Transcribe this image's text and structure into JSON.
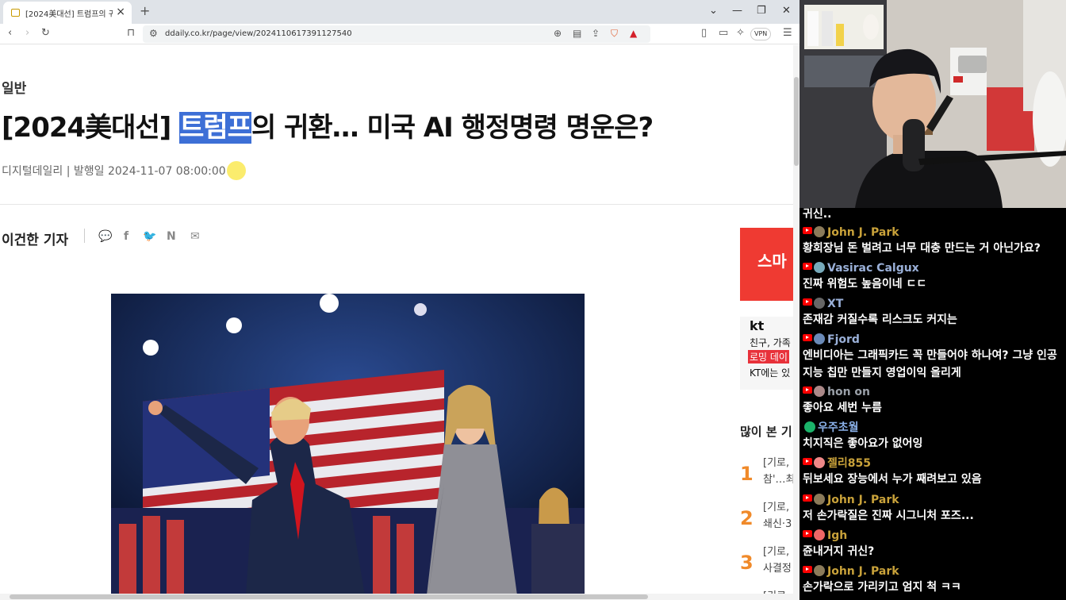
{
  "browser": {
    "tab_title": "[2024美대선] 트럼프의 귀환...",
    "url": "ddaily.co.kr/page/view/2024110617391127540",
    "vpn_label": "VPN"
  },
  "article": {
    "category": "일반",
    "headline_pre": "[2024美대선] ",
    "headline_highlight": "트럼프",
    "headline_post": "의 귀환… 미국 AI 행정명령 명운은?",
    "source": "디지털데일리",
    "date": "발행일 2024-11-07 08:00:00",
    "reporter": "이건한 기자"
  },
  "sidebar": {
    "ad1_text": "스마",
    "ad2_logo": "kt",
    "ad2_line1": "친구, 가족",
    "ad2_line2": "로밍 데이",
    "ad2_line3": "KT에는 있",
    "popular_title": "많이 본 기",
    "ranks": [
      {
        "num": "1",
        "line1": "[기로,",
        "line2": "참'…최"
      },
      {
        "num": "2",
        "line1": "[기로,",
        "line2": "쇄신·3"
      },
      {
        "num": "3",
        "line1": "[기로,",
        "line2": "사결정"
      }
    ],
    "rank4_partial": "[기로,"
  },
  "chat": {
    "top_text": "귀신..",
    "messages": [
      {
        "user": "John J. Park",
        "color": "#c9a23a",
        "text": "황회장님 돈 벌려고 너무 대충 만드는 거 아닌가요?"
      },
      {
        "user": "Vasirac Calgux",
        "color": "#9ab0d8",
        "text": "진짜 위험도 높음이네 ㄷㄷ"
      },
      {
        "user": "XT",
        "color": "#9ab0d8",
        "text": "존재감 커질수록 리스크도 커지는"
      },
      {
        "user": "Fjord",
        "color": "#9ab0d8",
        "text": "엔비디아는 그래픽카드 꼭 만들어야 하나여? 그냥 인공지능 칩만 만들지 영업이익 올리게"
      },
      {
        "user": "hon on",
        "color": "#9aa0a8",
        "text": "좋아요 세번 누름"
      },
      {
        "user": "우주초월",
        "color": "#8ab0e8",
        "text": "치지직은 좋아요가 없어잉"
      },
      {
        "user": "젤리855",
        "color": "#c9a23a",
        "text": "뒤보세요 장능에서 누가 째려보고 있음"
      },
      {
        "user": "John J. Park",
        "color": "#c9a23a",
        "text": "저 손가락질은 진짜 시그니처 포즈..."
      },
      {
        "user": "Igh",
        "color": "#c9a23a",
        "text": "쥰내거지 귀신?"
      },
      {
        "user": "John J. Park",
        "color": "#c9a23a",
        "text": "손가락으로 가리키고 엄지 척 ㅋㅋ"
      }
    ]
  }
}
